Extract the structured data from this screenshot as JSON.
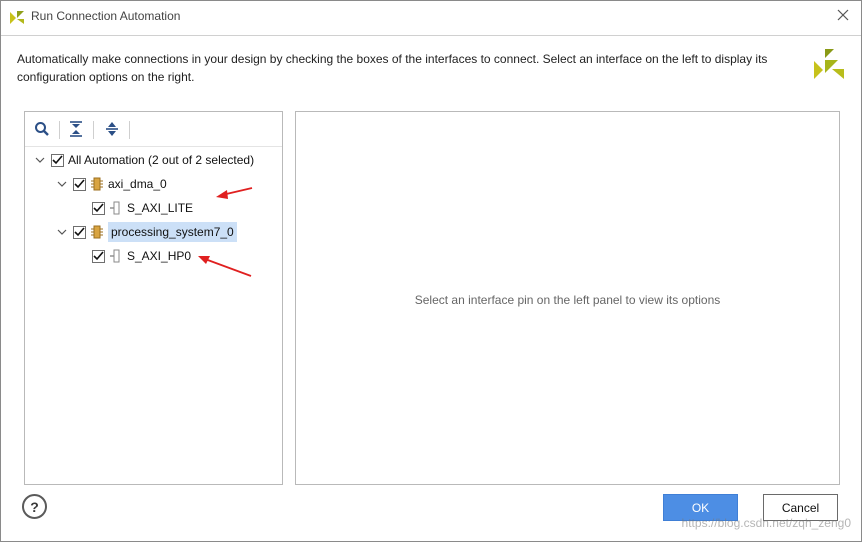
{
  "window": {
    "title": "Run Connection Automation",
    "close_icon": "close-icon"
  },
  "description": "Automatically make connections in your design by checking the boxes of the interfaces to connect. Select an interface on the left to display its configuration options on the right.",
  "toolbar": {
    "icons": [
      "search-icon",
      "collapse-all-icon",
      "expand-all-icon"
    ]
  },
  "tree": {
    "root": {
      "label": "All Automation (2 out of 2 selected)",
      "checked": true,
      "expanded": true
    },
    "nodes": [
      {
        "label": "axi_dma_0",
        "checked": true,
        "expanded": true,
        "icon": "ip-block-icon",
        "children": [
          {
            "label": "S_AXI_LITE",
            "checked": true,
            "icon": "interface-pin-icon"
          }
        ]
      },
      {
        "label": "processing_system7_0",
        "checked": true,
        "expanded": true,
        "selected": true,
        "icon": "ip-block-icon",
        "children": [
          {
            "label": "S_AXI_HP0",
            "checked": true,
            "icon": "interface-pin-icon"
          }
        ]
      }
    ]
  },
  "right_panel": {
    "placeholder": "Select an interface pin on the left panel to view its options"
  },
  "buttons": {
    "help": "?",
    "ok": "OK",
    "cancel": "Cancel"
  },
  "colors": {
    "accent": "#4d8ee4",
    "selection": "#cce0f7",
    "annotation_arrow": "#e02020",
    "brand": "#9aa81a"
  },
  "watermark": "https://blog.csdn.net/zqh_zeng0"
}
